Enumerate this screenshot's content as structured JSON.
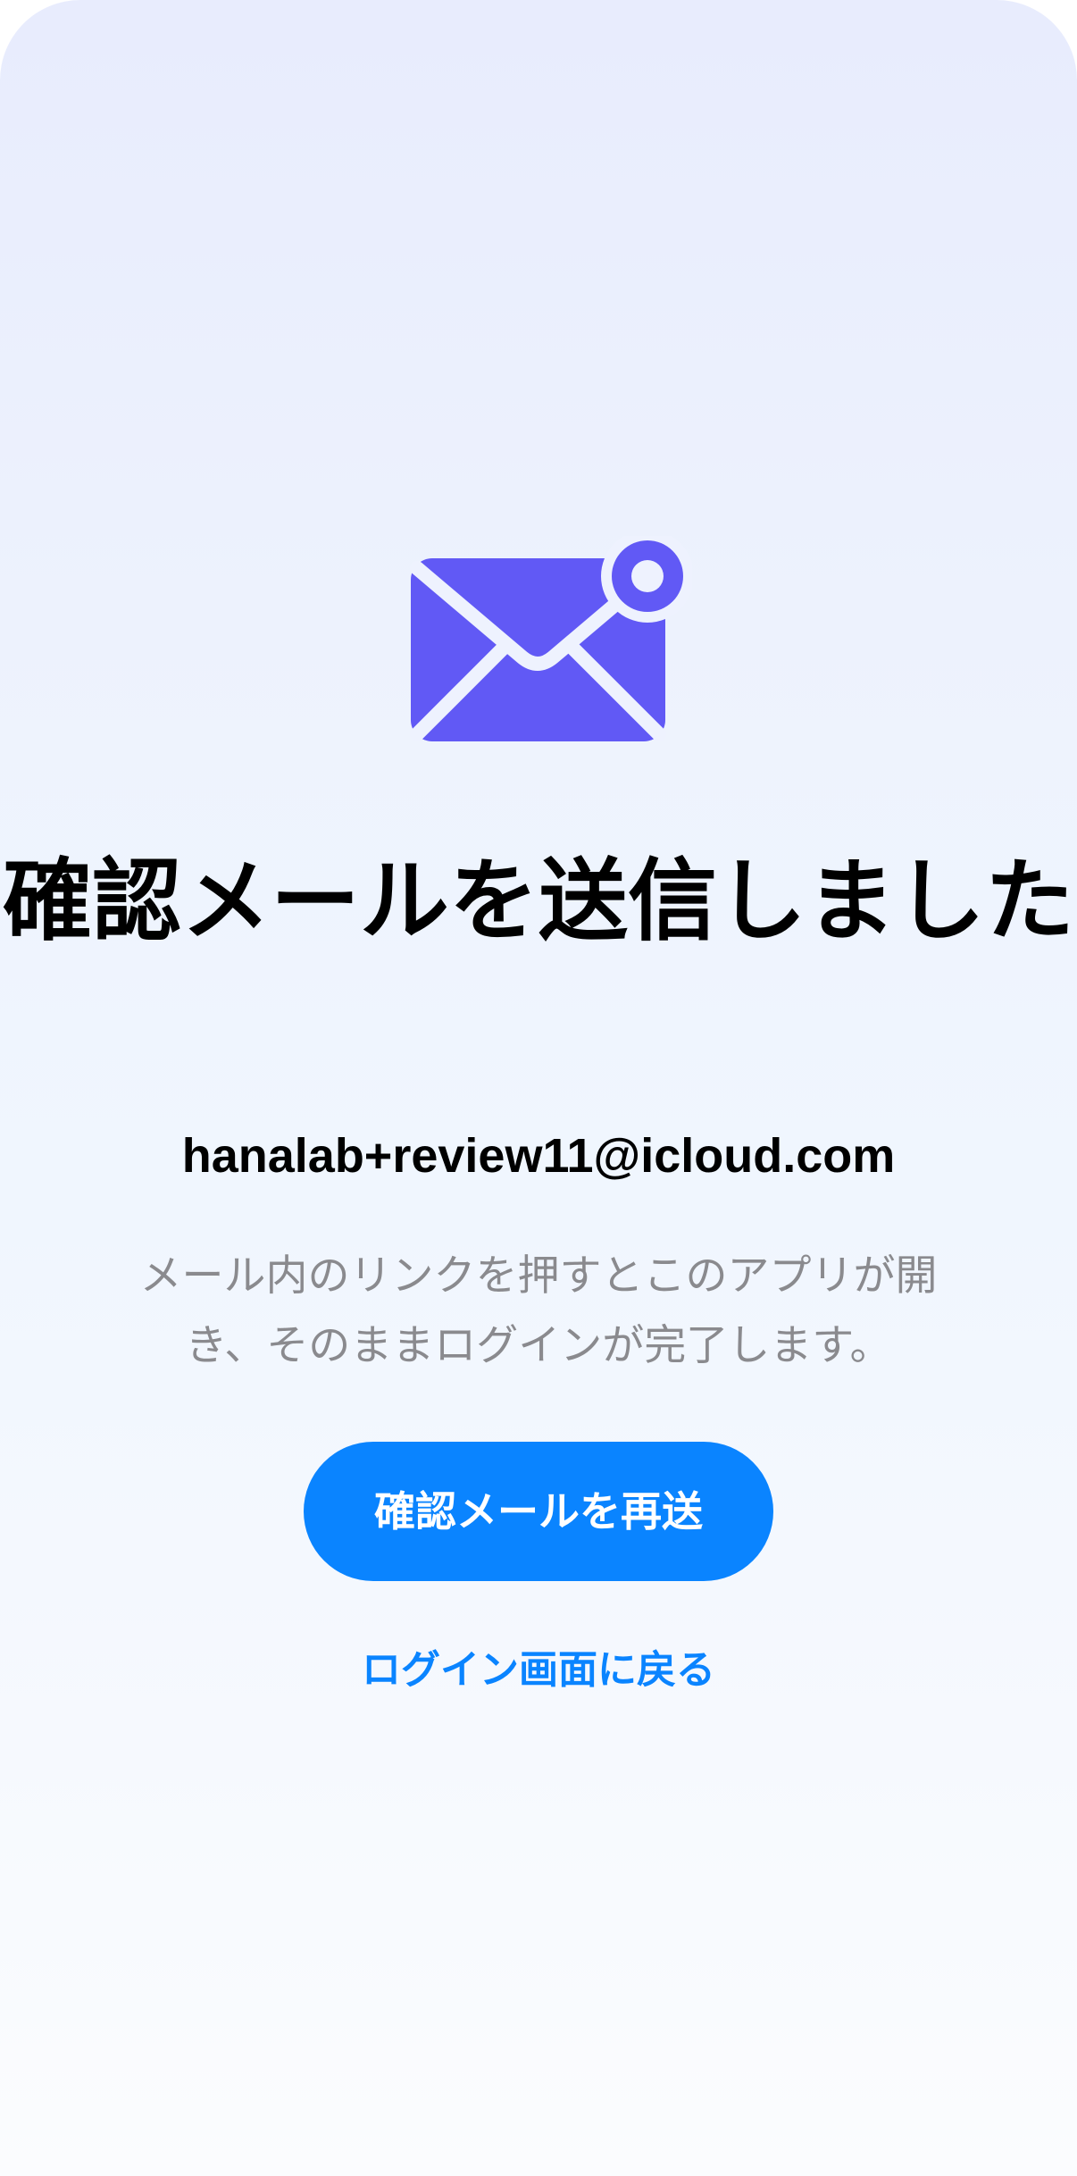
{
  "screen": {
    "title": "確認メールを送信しました",
    "email": "hanalab+review11@icloud.com",
    "message": "メール内のリンクを押すとこのアプリが開き、そのままログインが完了します。",
    "resend_button_label": "確認メールを再送",
    "back_link_label": "ログイン画面に戻る"
  },
  "icons": {
    "hero": "mail-with-badge-icon"
  },
  "colors": {
    "accent": "#0a84ff",
    "icon": "#6159f5",
    "title": "#000000",
    "secondary_text": "#8a8a8e"
  }
}
